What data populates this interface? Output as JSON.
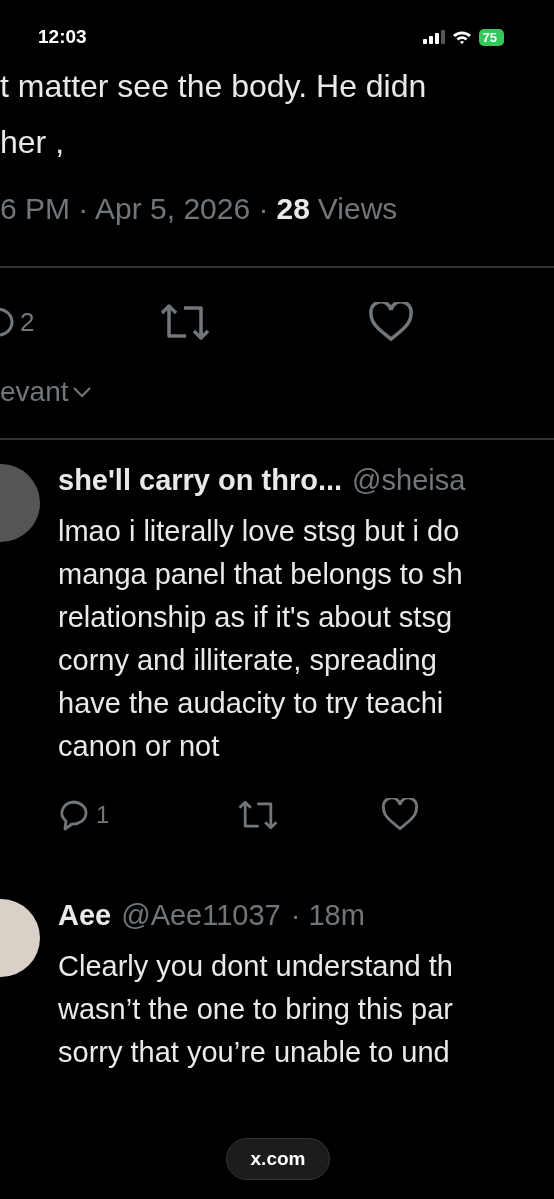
{
  "status_bar": {
    "time": "12:03",
    "battery": "75"
  },
  "main_post": {
    "text_lines": [
      "t matter see the body. He didn",
      "her ,"
    ],
    "timestamp": "6 PM · Apr 5, 2026 ·",
    "views_count": "28",
    "views_label": "Views",
    "reply_count": "2"
  },
  "sort": {
    "label": "evant"
  },
  "replies": [
    {
      "name": "she'll carry on thro...",
      "handle": "@sheisa",
      "lines": [
        "lmao i literally love stsg but i do",
        "manga panel that belongs to sh",
        "relationship as if it's about stsg",
        "corny and illiterate, spreading",
        "have the audacity to try teachi",
        "canon or not"
      ],
      "reply_count": "1"
    },
    {
      "name": "Aee",
      "handle": "@Aee11037",
      "time": "· 18m",
      "lines": [
        "Clearly you dont understand th",
        "wasn’t the one to bring this par",
        "sorry that you’re unable to und"
      ]
    }
  ],
  "url_bar": {
    "url": "x.com"
  }
}
